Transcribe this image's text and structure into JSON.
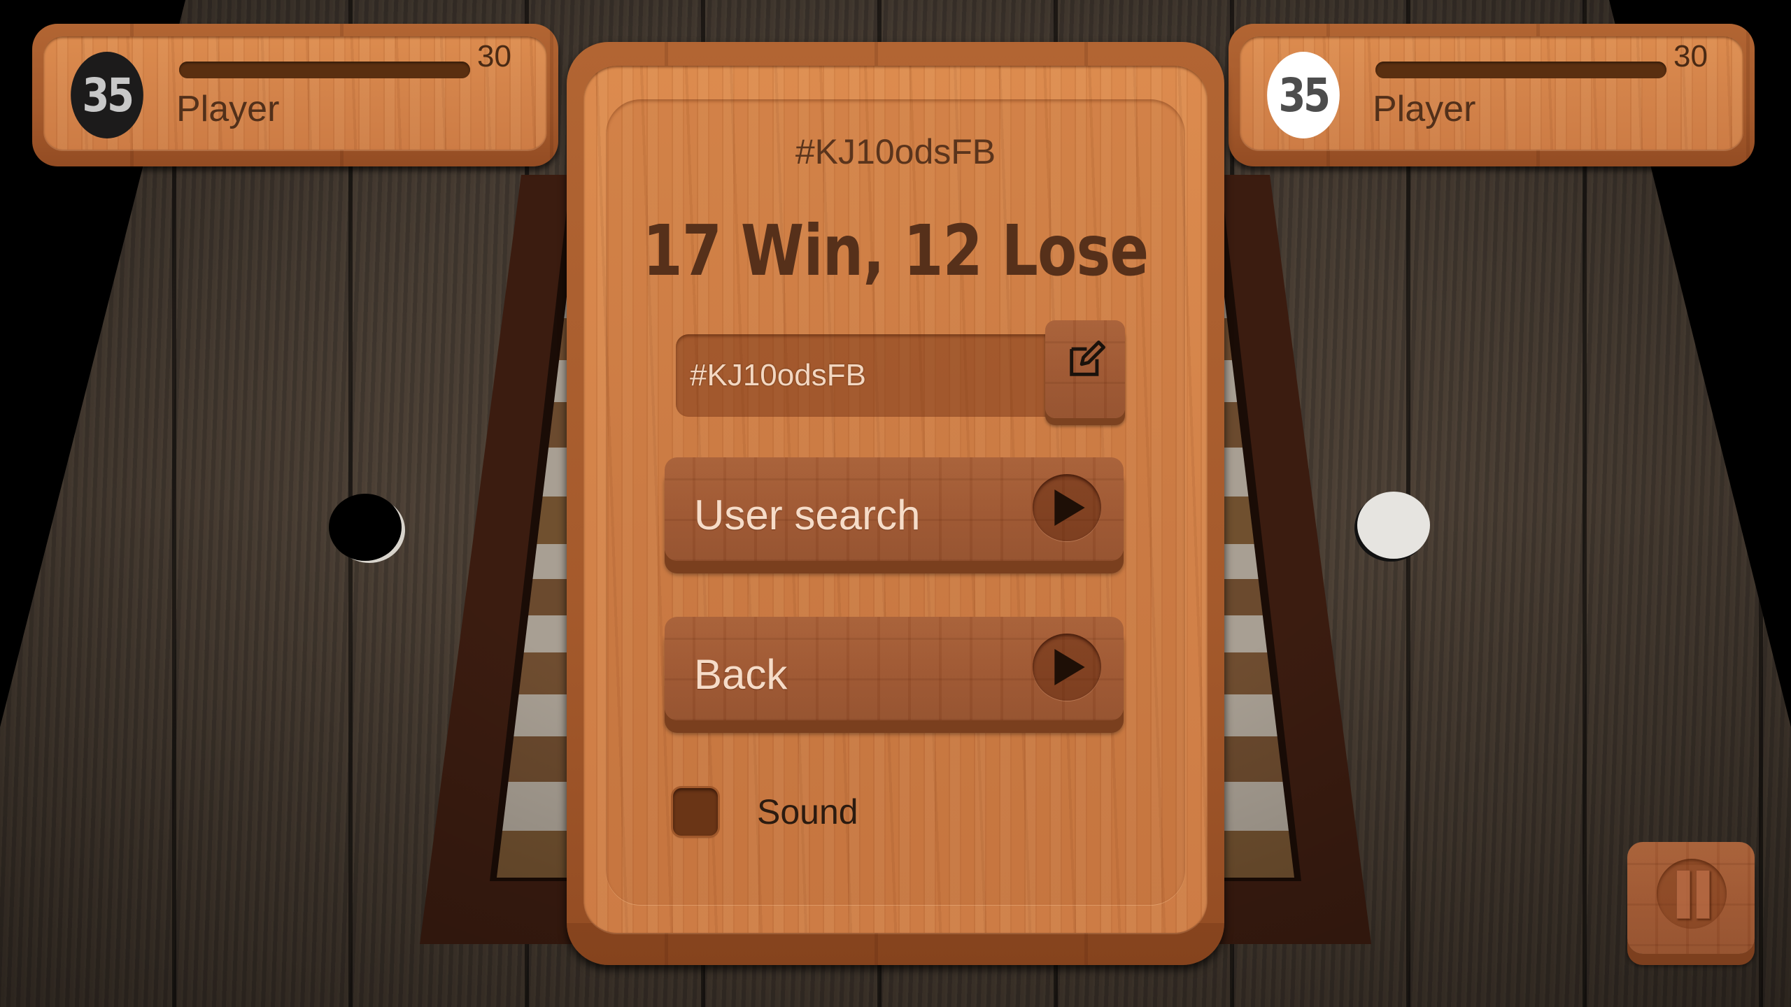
{
  "players": [
    {
      "side": "left",
      "color": "black",
      "score": "35",
      "level": "30",
      "name": "Player",
      "progress": 1.0
    },
    {
      "side": "right",
      "color": "white",
      "score": "35",
      "level": "30",
      "name": "Player",
      "progress": 1.0
    }
  ],
  "dialog": {
    "user_code": "#KJ10odsFB",
    "record": "17 Win, 12 Lose",
    "code_input": {
      "value": "#KJ10odsFB",
      "edit_icon": "edit-icon"
    },
    "buttons": [
      {
        "label": "User search",
        "icon": "play-icon"
      },
      {
        "label": "Back",
        "icon": "play-icon"
      }
    ],
    "sound": {
      "label": "Sound",
      "checked": false
    }
  },
  "pause_button": {
    "icon": "pause-icon"
  },
  "colors": {
    "panel_wood": "#d3834a",
    "rim_wood": "#a55a2c",
    "button_wood": "#9c5530",
    "text_dark": "#56301a",
    "text_light": "#f6dcc8",
    "table_wood": "#463b32"
  }
}
